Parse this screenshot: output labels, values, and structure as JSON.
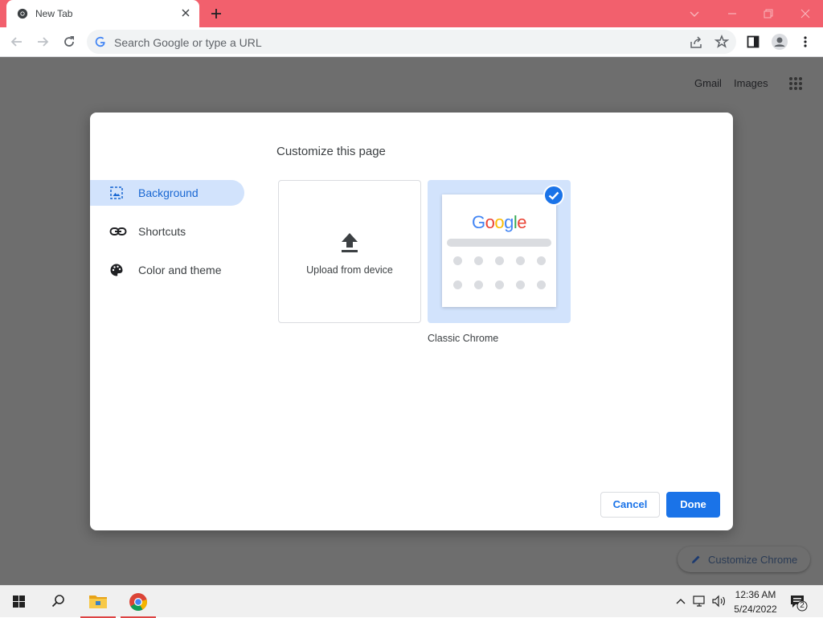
{
  "browser": {
    "tab_title": "New Tab",
    "omnibox_placeholder": "Search Google or type a URL",
    "theme_color": "#f2606d"
  },
  "page": {
    "top_links": [
      "Gmail",
      "Images"
    ],
    "customize_chrome_label": "Customize Chrome"
  },
  "dialog": {
    "title": "Customize this page",
    "nav": [
      {
        "label": "Background",
        "icon": "image-icon",
        "active": true
      },
      {
        "label": "Shortcuts",
        "icon": "link-icon",
        "active": false
      },
      {
        "label": "Color and theme",
        "icon": "palette-icon",
        "active": false
      }
    ],
    "upload_label": "Upload from device",
    "classic": {
      "logo": "Google",
      "label": "Classic Chrome",
      "selected": true
    },
    "cancel_label": "Cancel",
    "done_label": "Done"
  },
  "taskbar": {
    "time": "12:36 AM",
    "date": "5/24/2022",
    "notification_count": "2"
  }
}
